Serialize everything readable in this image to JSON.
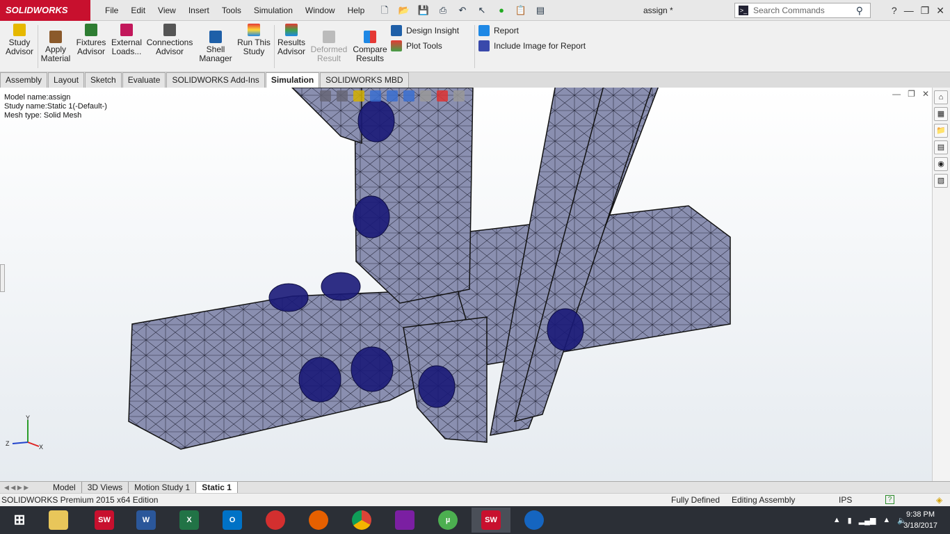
{
  "app": {
    "logo_text": "SOLIDWORKS",
    "document_title": "assign *"
  },
  "menu": [
    "File",
    "Edit",
    "View",
    "Insert",
    "Tools",
    "Simulation",
    "Window",
    "Help"
  ],
  "search": {
    "placeholder": "Search Commands"
  },
  "ribbon": {
    "study_advisor": "Study Advisor",
    "apply_material": "Apply Material",
    "fixtures_advisor": "Fixtures Advisor",
    "external_loads": "External Loads...",
    "connections_advisor": "Connections Advisor",
    "shell_manager": "Shell Manager",
    "run_study": "Run This Study",
    "results_advisor": "Results Advisor",
    "deformed_result": "Deformed Result",
    "compare_results": "Compare Results",
    "design_insight": "Design Insight",
    "plot_tools": "Plot Tools",
    "report": "Report",
    "include_image": "Include Image for Report"
  },
  "tabs": [
    "Assembly",
    "Layout",
    "Sketch",
    "Evaluate",
    "SOLIDWORKS Add-Ins",
    "Simulation",
    "SOLIDWORKS MBD"
  ],
  "active_tab": "Simulation",
  "model_info": {
    "model_name": "Model name:assign",
    "study_name": "Study name:Static 1(-Default-)",
    "mesh_type": "Mesh type: Solid Mesh"
  },
  "axes": {
    "x": "X",
    "y": "Y",
    "z": "Z"
  },
  "bottom_tabs": [
    "Model",
    "3D Views",
    "Motion Study 1",
    "Static 1"
  ],
  "status": {
    "edition": "SOLIDWORKS Premium 2015 x64 Edition",
    "state": "Fully Defined",
    "mode": "Editing Assembly",
    "units": "IPS"
  },
  "clock": {
    "time": "9:38 PM",
    "date": "3/18/2017"
  },
  "colors": {
    "mesh": "#8a8fb0",
    "bolt": "#1a1a78",
    "accent": "#c8102e"
  }
}
